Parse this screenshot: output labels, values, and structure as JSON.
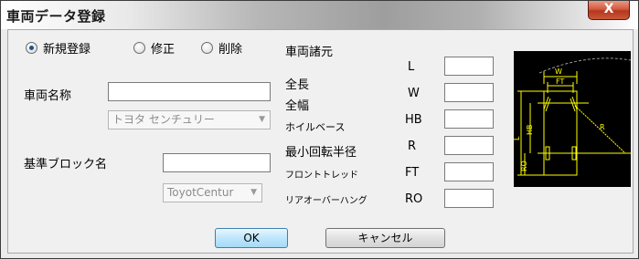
{
  "window": {
    "title": "車両データ登録",
    "close_label": "X"
  },
  "mode": {
    "options": [
      {
        "label": "新規登録",
        "selected": true
      },
      {
        "label": "修正",
        "selected": false
      },
      {
        "label": "削除",
        "selected": false
      }
    ]
  },
  "vehicle": {
    "name_label": "車両名称",
    "name_value": "",
    "preset_combo": "トヨタ センチュリー",
    "block_label": "基準ブロック名",
    "block_value": "",
    "block_combo": "ToyotCentur"
  },
  "specs": {
    "section_title": "車両諸元",
    "rows": [
      {
        "name": "全長",
        "code": "L",
        "value": ""
      },
      {
        "name": "全幅",
        "code": "W",
        "value": ""
      },
      {
        "name": "ホイルベース",
        "code": "HB",
        "value": ""
      },
      {
        "name": "最小回転半径",
        "code": "R",
        "value": ""
      },
      {
        "name": "フロントトレッド",
        "code": "FT",
        "value": ""
      },
      {
        "name": "リアオーバーハング",
        "code": "RO",
        "value": ""
      }
    ]
  },
  "diagram": {
    "labels": {
      "w": "W",
      "ft": "FT",
      "l": "L",
      "hb": "HB",
      "r": "R",
      "ro": "RO"
    },
    "color": "#ffff00"
  },
  "buttons": {
    "ok": "OK",
    "cancel": "キャンセル"
  }
}
